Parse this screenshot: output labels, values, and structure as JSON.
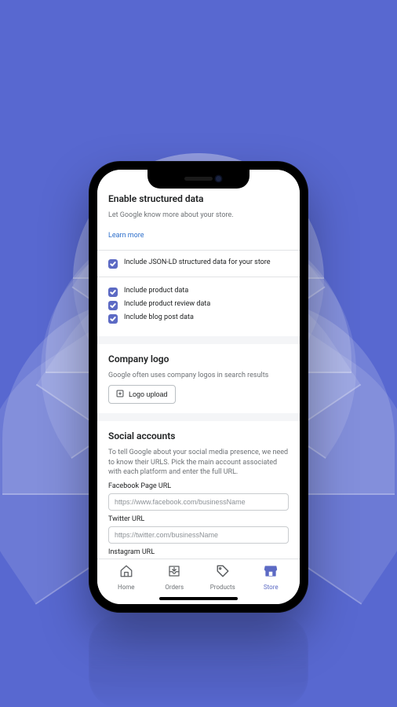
{
  "sections": {
    "structured": {
      "title": "Enable structured data",
      "desc": "Let Google know more about your store.",
      "learn_more": "Learn more",
      "main_checkbox": "Include JSON-LD structured data for your store",
      "items": [
        "Include product data",
        "Include product review data",
        "Include blog post data"
      ]
    },
    "logo": {
      "title": "Company logo",
      "desc": "Google often uses company logos in search results",
      "upload_label": "Logo upload"
    },
    "social": {
      "title": "Social accounts",
      "desc": "To tell Google about your social media presence, we need to know their URLS. Pick the main account associated with each platform and enter the full URL.",
      "facebook_label": "Facebook Page URL",
      "facebook_placeholder": "https://www.facebook.com/businessName",
      "twitter_label": "Twitter URL",
      "twitter_placeholder": "https://twitter.com/businessName",
      "instagram_label": "Instagram URL"
    }
  },
  "tabs": {
    "home": "Home",
    "orders": "Orders",
    "products": "Products",
    "store": "Store"
  }
}
